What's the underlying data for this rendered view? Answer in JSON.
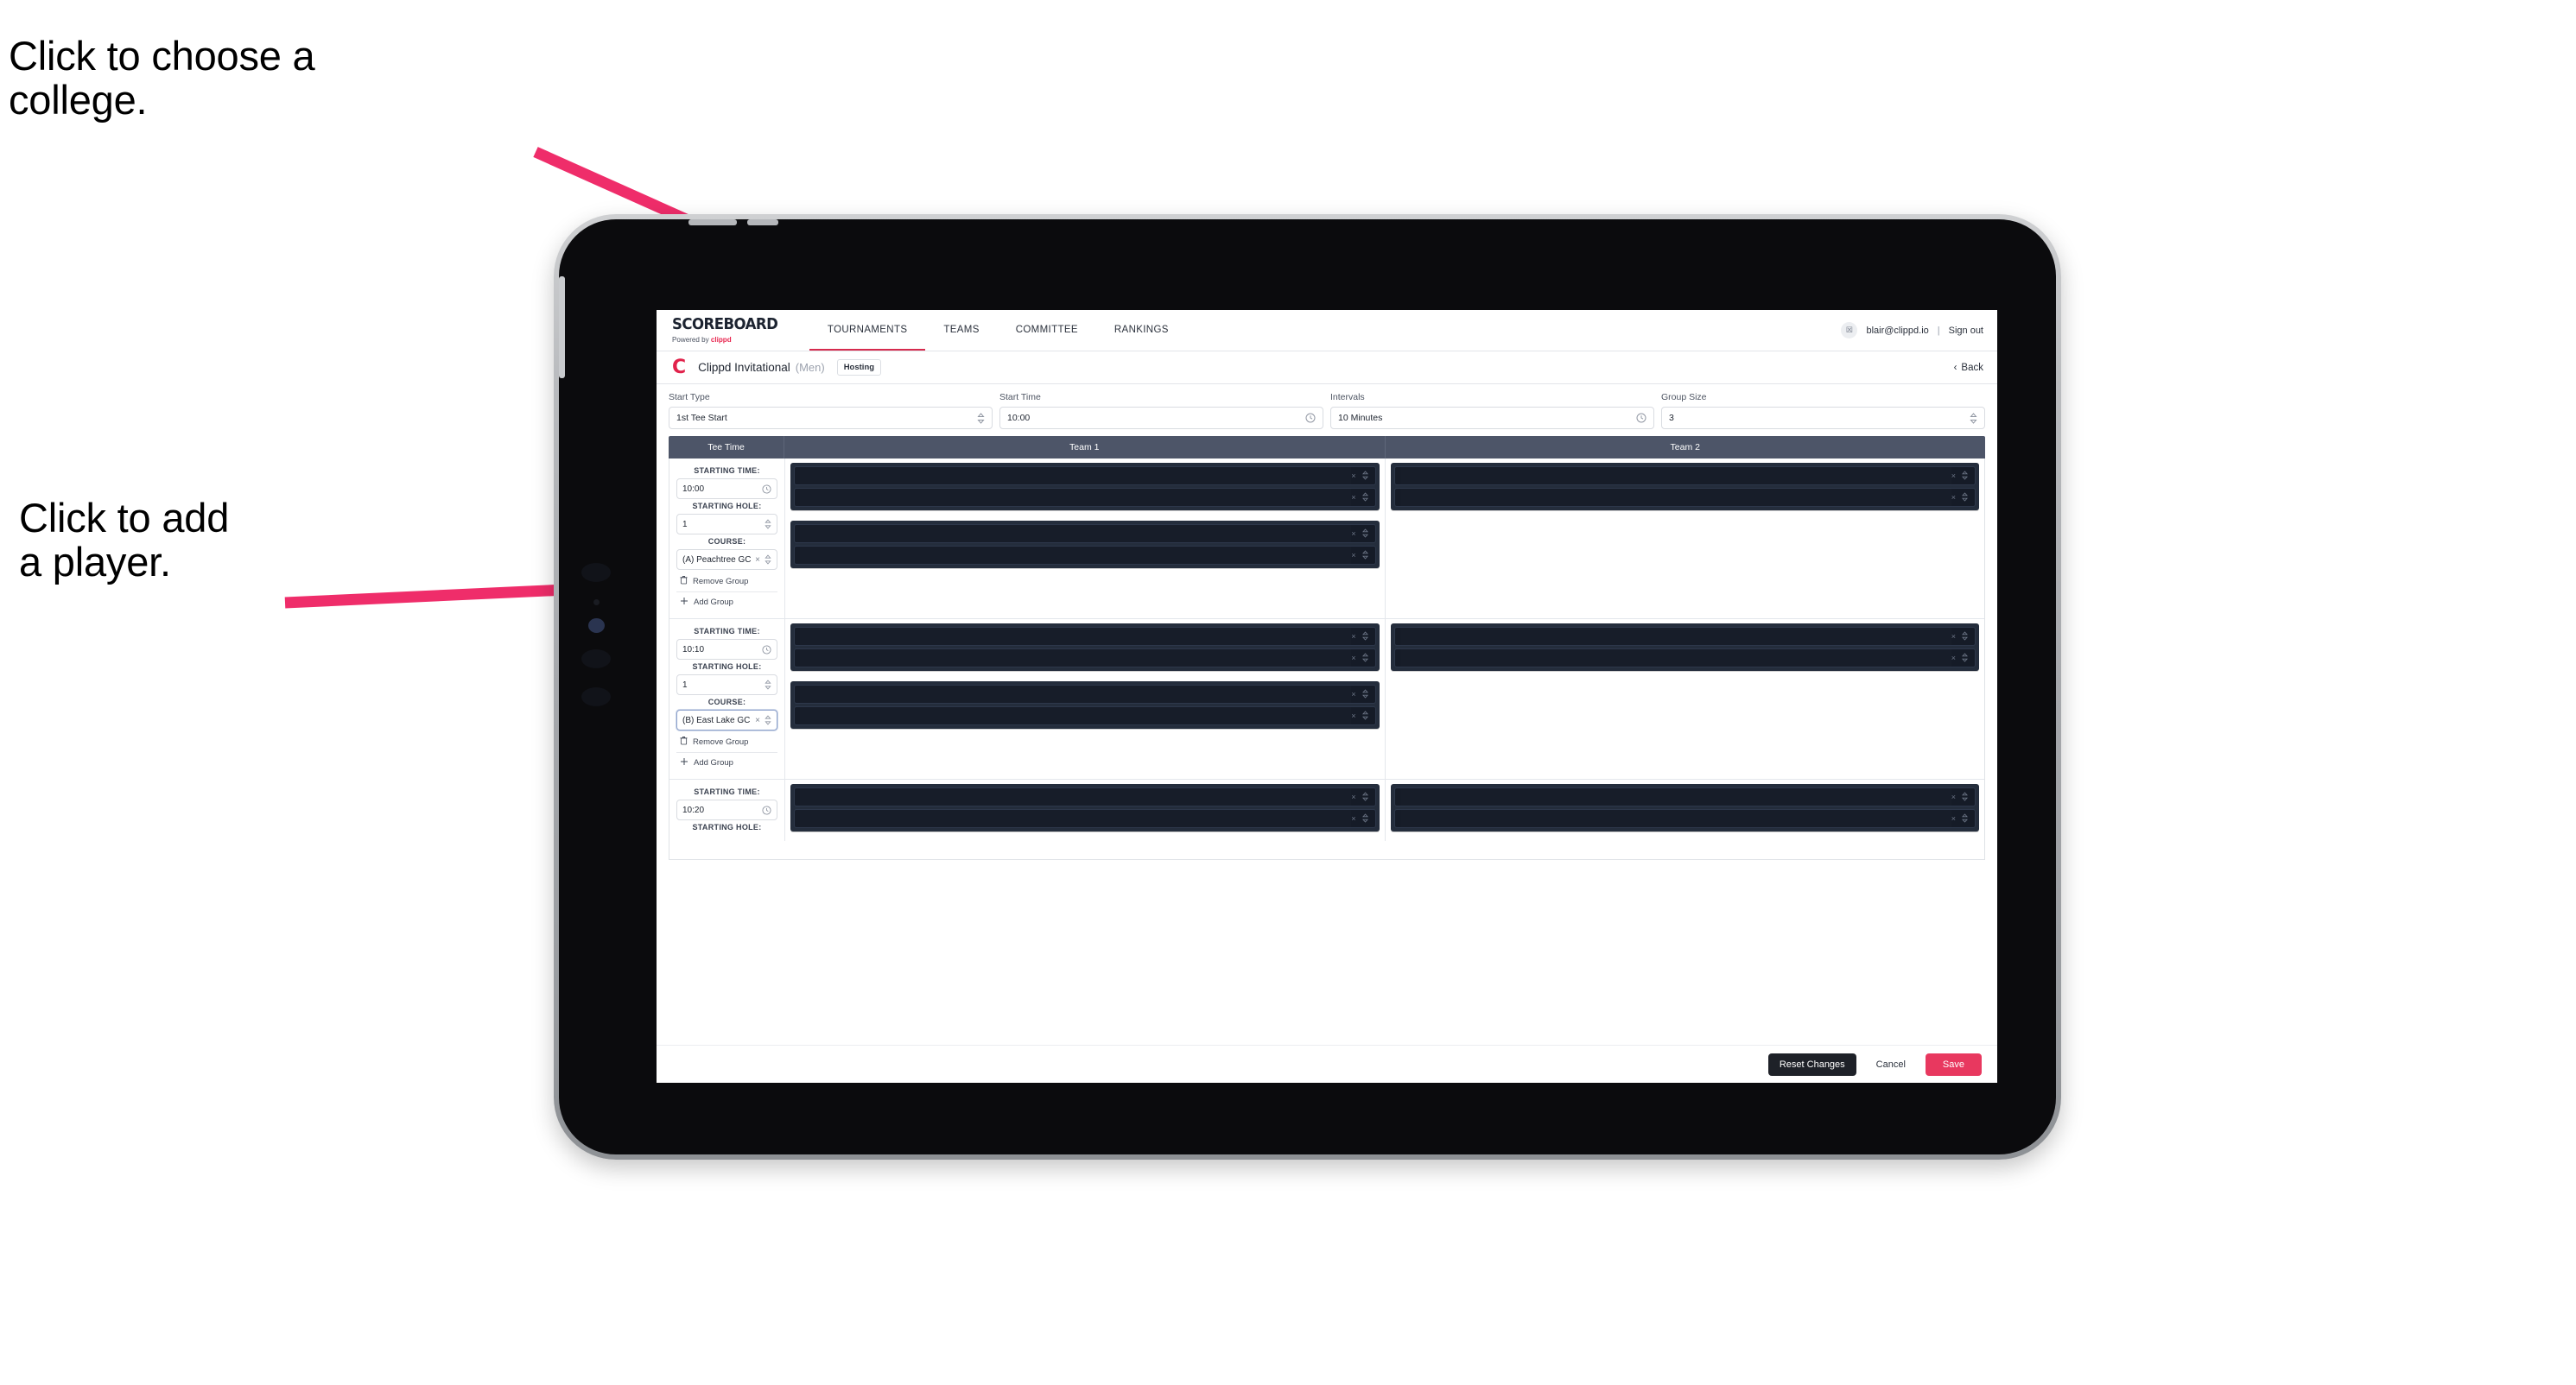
{
  "annotations": {
    "college": "Click to choose a\ncollege.",
    "player": "Click to add\na player."
  },
  "colors": {
    "accent_pink": "#e8385f",
    "brand_red": "#e1224b",
    "header_slate": "#4d5568",
    "player_box": "#242d3c",
    "player_row": "#151b27",
    "annotation_arrow": "#ef2d6a"
  },
  "nav": {
    "logo_word": "SCOREBOARD",
    "logo_sub_prefix": "Powered by ",
    "logo_sub_brand": "clippd",
    "tabs": [
      {
        "label": "TOURNAMENTS",
        "active": true
      },
      {
        "label": "TEAMS",
        "active": false
      },
      {
        "label": "COMMITTEE",
        "active": false
      },
      {
        "label": "RANKINGS",
        "active": false
      }
    ],
    "avatar_glyph": "☒",
    "email": "blair@clippd.io",
    "divider": "|",
    "sign_out": "Sign out"
  },
  "tournament_bar": {
    "logo_letter": "C",
    "name": "Clippd Invitational",
    "gender": "(Men)",
    "role_badge": "Hosting",
    "back_label": "Back",
    "back_chevron": "‹"
  },
  "filters": [
    {
      "label": "Start Type",
      "value": "1st Tee Start",
      "icon": "stepper-icon"
    },
    {
      "label": "Start Time",
      "value": "10:00",
      "icon": "clock-icon"
    },
    {
      "label": "Intervals",
      "value": "10 Minutes",
      "icon": "clock-icon"
    },
    {
      "label": "Group Size",
      "value": "3",
      "icon": "stepper-icon"
    }
  ],
  "table": {
    "headers": [
      "Tee Time",
      "Team 1",
      "Team 2"
    ],
    "field_labels": {
      "starting_time": "STARTING TIME:",
      "starting_hole": "STARTING HOLE:",
      "course": "COURSE:"
    },
    "group_actions": {
      "remove": "Remove Group",
      "add": "Add Group"
    },
    "rows": [
      {
        "starting_time": "10:00",
        "starting_hole": "1",
        "course": "(A) Peachtree GC",
        "course_focused": false,
        "team1_groups": [
          2,
          2
        ],
        "team2_groups": [
          2
        ]
      },
      {
        "starting_time": "10:10",
        "starting_hole": "1",
        "course": "(B) East Lake GC",
        "course_focused": true,
        "team1_groups": [
          2,
          2
        ],
        "team2_groups": [
          2
        ]
      },
      {
        "starting_time": "10:20",
        "starting_hole": "",
        "course": "",
        "course_focused": false,
        "team1_groups": [
          2
        ],
        "team2_groups": [
          2
        ]
      }
    ]
  },
  "footer": {
    "reset_label": "Reset Changes",
    "cancel_label": "Cancel",
    "save_label": "Save"
  }
}
